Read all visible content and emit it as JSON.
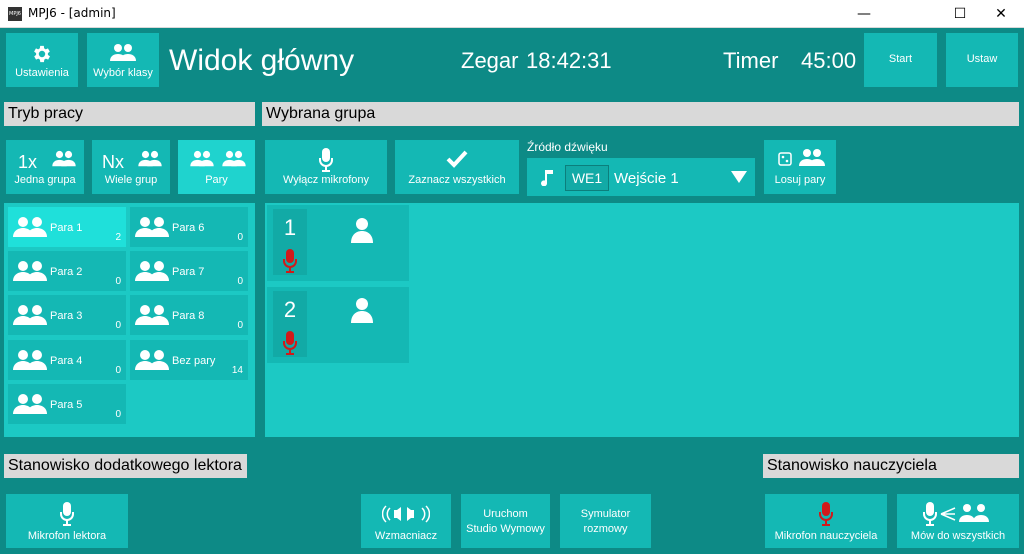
{
  "window": {
    "title": "MPJ6 - [admin]",
    "app_icon_text": "MPJ6",
    "controls": [
      "—",
      "☐",
      "✕"
    ]
  },
  "toolbar": {
    "settings_label": "Ustawienia",
    "class_select_label": "Wybór klasy",
    "main_title": "Widok główny",
    "clock_label": "Zegar",
    "clock_value": "18:42:31",
    "timer_label": "Timer",
    "timer_value": "45:00",
    "start_label": "Start",
    "set_label": "Ustaw"
  },
  "mode_section": {
    "title": "Tryb pracy",
    "modes": [
      {
        "prefix": "1x",
        "label": "Jedna grupa",
        "selected": false
      },
      {
        "prefix": "Nx",
        "label": "Wiele grup",
        "selected": false
      },
      {
        "prefix": "",
        "label": "Pary",
        "selected": true
      }
    ],
    "pairs": [
      {
        "name": "Para 1",
        "count": "2",
        "selected": true
      },
      {
        "name": "Para 2",
        "count": "0",
        "selected": false
      },
      {
        "name": "Para 3",
        "count": "0",
        "selected": false
      },
      {
        "name": "Para 4",
        "count": "0",
        "selected": false
      },
      {
        "name": "Para 5",
        "count": "0",
        "selected": false
      },
      {
        "name": "Para 6",
        "count": "0",
        "selected": false
      },
      {
        "name": "Para 7",
        "count": "0",
        "selected": false
      },
      {
        "name": "Para 8",
        "count": "0",
        "selected": false
      },
      {
        "name": "Bez pary",
        "count": "14",
        "selected": false
      }
    ]
  },
  "group_section": {
    "title": "Wybrana grupa",
    "mute_mic_label": "Wyłącz mikrofony",
    "select_all_label": "Zaznacz wszystkich",
    "sound_source_label": "Źródło dźwięku",
    "sound_source_code": "WE1",
    "sound_source_value": "Wejście 1",
    "shuffle_pairs_label": "Losuj pary",
    "seats": [
      {
        "number": "1"
      },
      {
        "number": "2"
      }
    ]
  },
  "lector_section": {
    "title": "Stanowisko dodatkowego lektora",
    "lector_mic_label": "Mikrofon lektora"
  },
  "bottom_center": {
    "amplifier_label": "Wzmacniacz",
    "studio_label_line1": "Uruchom",
    "studio_label_line2": "Studio Wymowy",
    "simulator_label_line1": "Symulator",
    "simulator_label_line2": "rozmowy"
  },
  "teacher_section": {
    "title": "Stanowisko nauczyciela",
    "teacher_mic_label": "Mikrofon nauczyciela",
    "speak_all_label": "Mów do wszystkich"
  },
  "colors": {
    "background": "#0d8a86",
    "tile": "#14b8b4",
    "tile_selected": "#1fe0da",
    "panel": "#1cc9c4",
    "mic_red": "#d11a1a",
    "section_label_bg": "#d9d9d9"
  }
}
